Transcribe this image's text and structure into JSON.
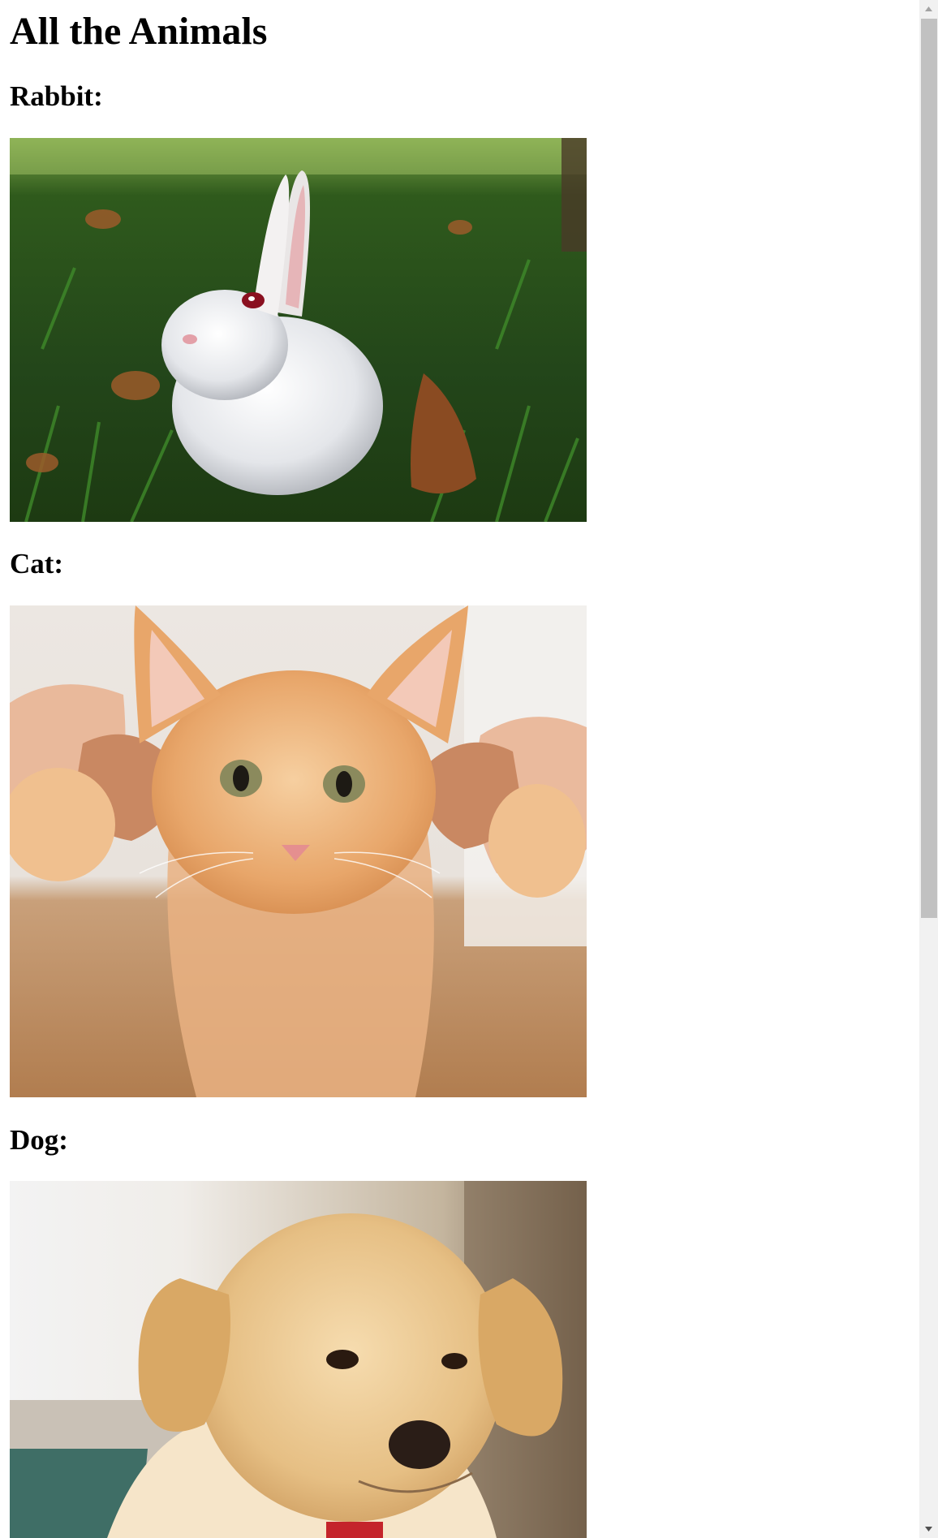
{
  "page": {
    "title": "All the Animals"
  },
  "sections": [
    {
      "heading": "Rabbit:",
      "image_subject": "white rabbit sitting in green grass"
    },
    {
      "heading": "Cat:",
      "image_subject": "orange tabby kitten held by hands"
    },
    {
      "heading": "Dog:",
      "image_subject": "golden retriever puppy with red collar"
    }
  ],
  "scrollbar": {
    "position": 0.0
  },
  "colors": {
    "background": "#ffffff",
    "text": "#000000",
    "scroll_track": "#f1f1f1",
    "scroll_thumb": "#c1c1c1"
  }
}
